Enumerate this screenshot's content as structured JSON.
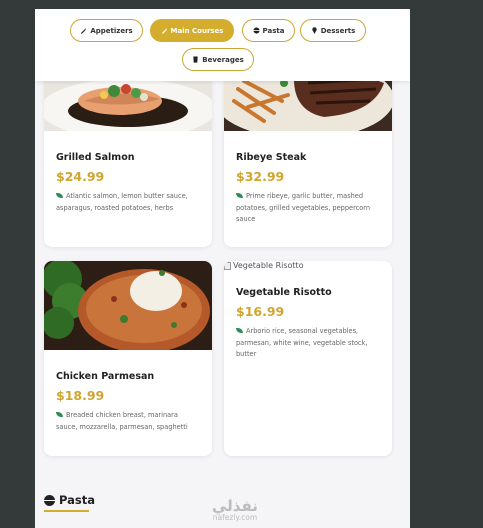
{
  "tabs": [
    {
      "label": "Appetizers",
      "icon": "utensil-icon",
      "active": false
    },
    {
      "label": "Main Courses",
      "icon": "utensil-icon",
      "active": true
    },
    {
      "label": "Pasta",
      "icon": "bowl-icon",
      "active": false
    },
    {
      "label": "Desserts",
      "icon": "ice-cream-icon",
      "active": false
    },
    {
      "label": "Beverages",
      "icon": "glass-icon",
      "active": false
    }
  ],
  "dishes": [
    {
      "name": "Grilled Salmon",
      "price": "$24.99",
      "ingredients": "Atlantic salmon, lemon butter sauce, asparagus, roasted potatoes, herbs"
    },
    {
      "name": "Ribeye Steak",
      "price": "$32.99",
      "ingredients": "Prime ribeye, garlic butter, mashed potatoes, grilled vegetables, peppercorn sauce"
    },
    {
      "name": "Chicken Parmesan",
      "price": "$18.99",
      "ingredients": "Breaded chicken breast, marinara sauce, mozzarella, parmesan, spaghetti"
    },
    {
      "name": "Vegetable Risotto",
      "price": "$16.99",
      "ingredients": "Arborio rice, seasonal vegetables, parmesan, white wine, vegetable stock, butter",
      "image_alt": "Vegetable Risotto"
    }
  ],
  "section": {
    "title": "Pasta",
    "icon": "bowl-icon"
  },
  "watermark": {
    "arabic": "نفذلي",
    "latin": "nafezly.com"
  },
  "colors": {
    "accent": "#d4ac2e",
    "price": "#d1a42d",
    "leaf": "#2e8b57",
    "backdrop": "#34393a"
  }
}
